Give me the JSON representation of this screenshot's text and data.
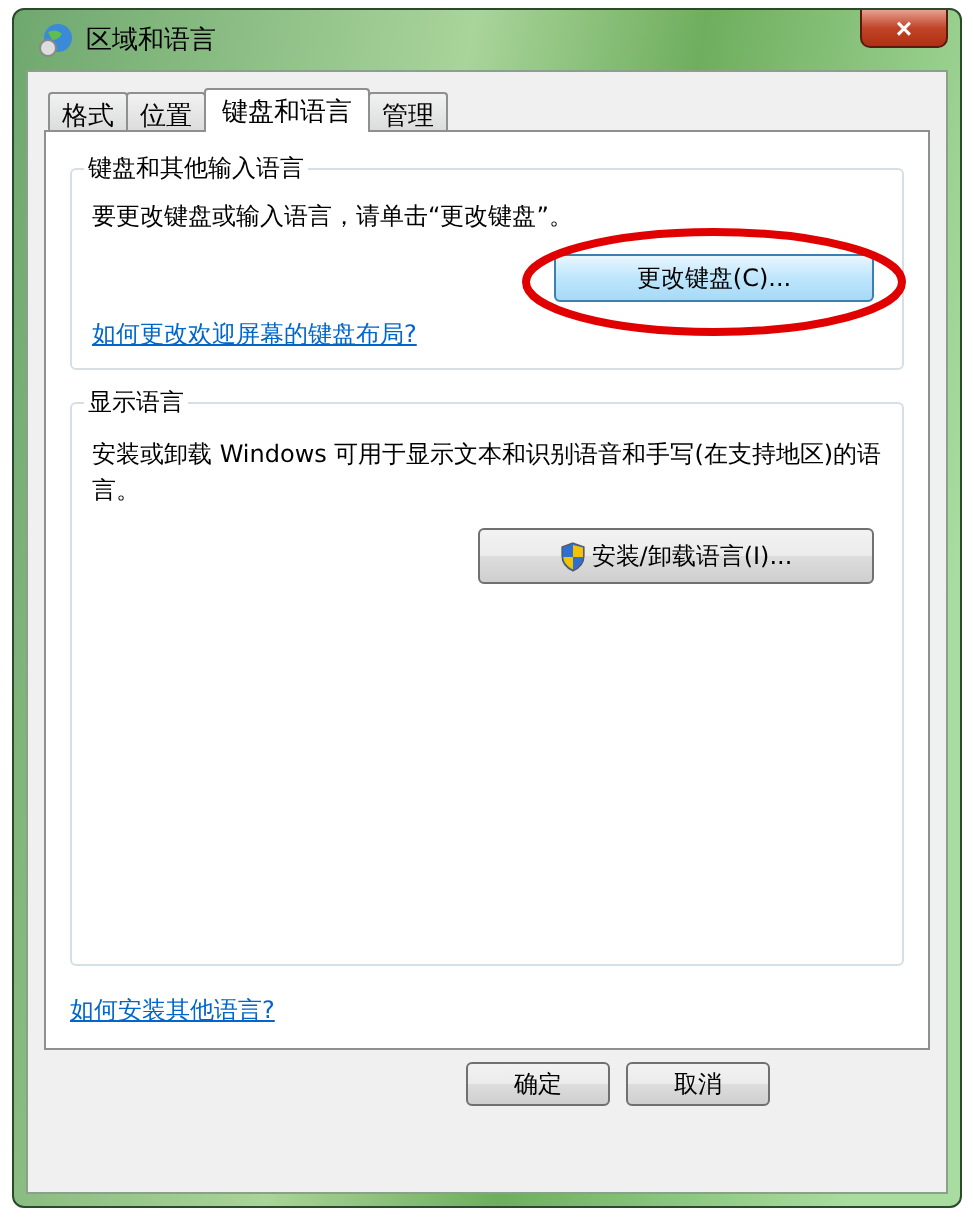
{
  "window": {
    "title": "区域和语言",
    "close_label": "×"
  },
  "tabs": [
    {
      "label": "格式",
      "selected": false
    },
    {
      "label": "位置",
      "selected": false
    },
    {
      "label": "键盘和语言",
      "selected": true
    },
    {
      "label": "管理",
      "selected": false
    }
  ],
  "keyboard_group": {
    "title": "键盘和其他输入语言",
    "text": "要更改键盘或输入语言，请单击“更改键盘”。",
    "button": {
      "label": "更改键盘(C)...",
      "highlighted": true
    },
    "link": "如何更改欢迎屏幕的键盘布局?"
  },
  "display_group": {
    "title": "显示语言",
    "text": "安装或卸载 Windows 可用于显示文本和识别语音和手写(在支持地区)的语言。",
    "button": {
      "label": "安装/卸载语言(I)...",
      "shield": true
    }
  },
  "bottom_link": "如何安装其他语言?",
  "buttons": [
    {
      "label": "确定"
    },
    {
      "label": "取消"
    }
  ]
}
